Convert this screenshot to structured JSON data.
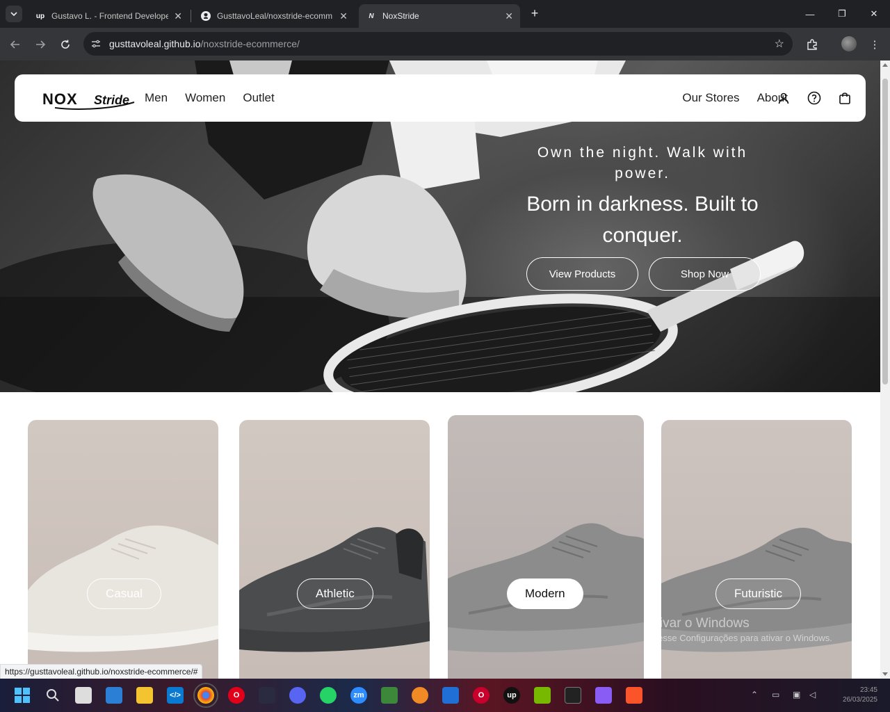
{
  "browser": {
    "tabs": [
      {
        "title": "Gustavo L. - Frontend Develope",
        "favicon": "up"
      },
      {
        "title": "GusttavoLeal/noxstride-ecomm",
        "favicon": "github-icon"
      },
      {
        "title": "NoxStride",
        "favicon": "N"
      }
    ],
    "url_host": "gusttavoleal.github.io",
    "url_path": "/noxstride-ecommerce/",
    "status_url": "https://gusttavoleal.github.io/noxstride-ecommerce/#"
  },
  "site": {
    "logo_main": "NOX",
    "logo_script": "Stride",
    "nav_left": [
      "Men",
      "Women",
      "Outlet"
    ],
    "nav_right": [
      "Our Stores",
      "About"
    ],
    "hero": {
      "tagline": "Own the night. Walk with power.",
      "headline": "Born in darkness. Built to conquer.",
      "buttons": [
        "View Products",
        "Shop Now"
      ]
    },
    "categories": [
      {
        "label": "Casual",
        "style": "outline",
        "shoe_color": "#e6e2dc"
      },
      {
        "label": "Athletic",
        "style": "outline",
        "shoe_color": "#4a4c4d"
      },
      {
        "label": "Modern",
        "style": "solid",
        "shoe_color": "#8c8c8c"
      },
      {
        "label": "Futuristic",
        "style": "outline",
        "shoe_color": "#8a8a8a"
      }
    ]
  },
  "os": {
    "watermark_title": "Ativar o Windows",
    "watermark_text": "Acesse Configurações para ativar o Windows.",
    "clock_time": "23:45",
    "clock_date": "26/03/2025"
  },
  "colors": {
    "chrome_dark": "#202124",
    "chrome_toolbar": "#35363a",
    "card_bg": "#cbbfb9"
  }
}
